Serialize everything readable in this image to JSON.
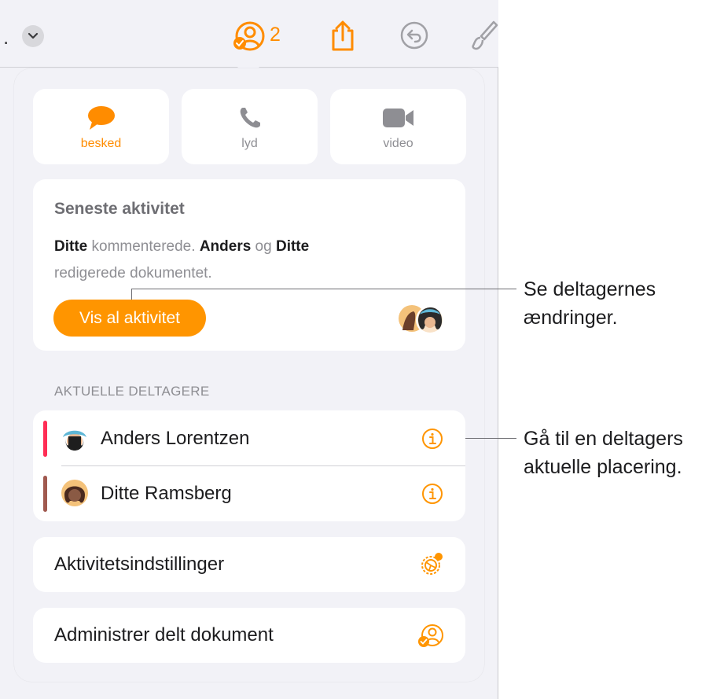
{
  "toolbar": {
    "collaborator_count": "2"
  },
  "contact": {
    "message_label": "besked",
    "audio_label": "lyd",
    "video_label": "video"
  },
  "recent": {
    "title": "Seneste aktivitet",
    "line1": [
      {
        "text": "Ditte",
        "bold": true
      },
      {
        "text": " kommenterede. ",
        "bold": false
      },
      {
        "text": "Anders",
        "bold": true
      },
      {
        "text": " og ",
        "bold": false
      },
      {
        "text": "Ditte",
        "bold": true
      }
    ],
    "line2": "redigerede dokumentet.",
    "show_all_label": "Vis al aktivitet"
  },
  "participants": {
    "heading": "AKTUELLE DELTAGERE",
    "items": [
      {
        "name": "Anders Lorentzen",
        "color": "#ff2d55"
      },
      {
        "name": "Ditte Ramsberg",
        "color": "#a0594f"
      }
    ]
  },
  "settings": {
    "activity_settings_label": "Aktivitetsindstillinger",
    "manage_label": "Administrer delt dokument"
  },
  "callouts": {
    "first_line1": "Se deltagernes",
    "first_line2": "ændringer.",
    "second_line1": "Gå til en deltagers",
    "second_line2": "aktuelle placering."
  },
  "colors": {
    "accent": "#ff9500",
    "background": "#f2f2f7"
  },
  "icons": [
    "chevron-down-icon",
    "collaborate-icon",
    "share-icon",
    "undo-icon",
    "paintbrush-icon",
    "message-bubble-icon",
    "phone-icon",
    "video-camera-icon",
    "info-icon",
    "activity-settings-icon",
    "manage-shared-icon"
  ]
}
